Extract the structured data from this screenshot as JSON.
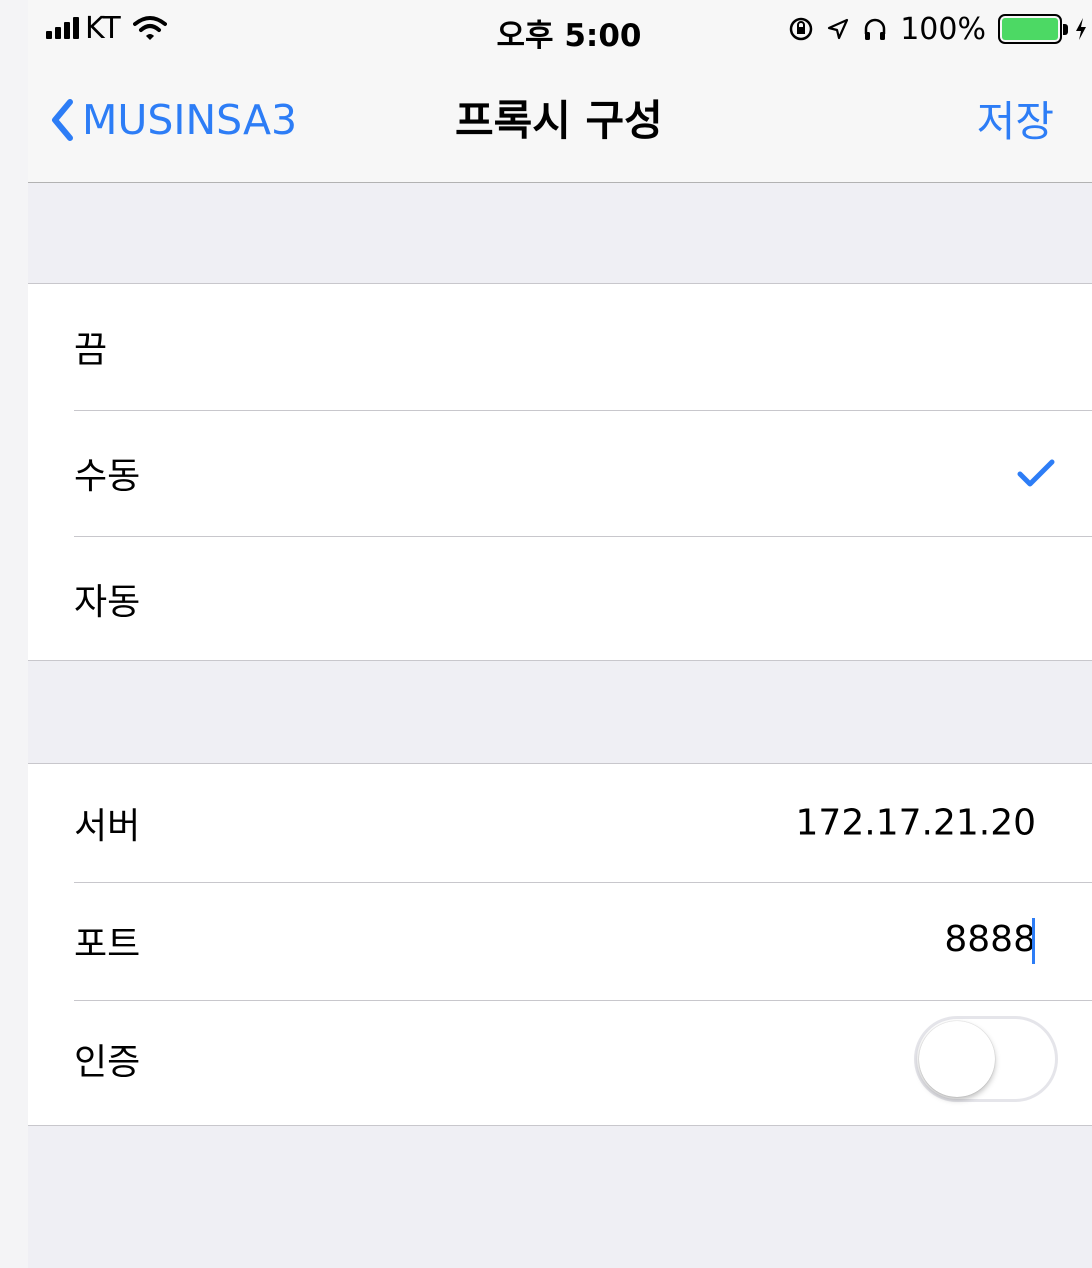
{
  "status_bar": {
    "carrier": "KT",
    "time": "오후 5:00",
    "battery_percent": "100%"
  },
  "nav": {
    "back_label": "MUSINSA3",
    "title": "프록시 구성",
    "save_label": "저장"
  },
  "proxy_modes": [
    {
      "label": "끔",
      "selected": false
    },
    {
      "label": "수동",
      "selected": true
    },
    {
      "label": "자동",
      "selected": false
    }
  ],
  "settings": {
    "server_label": "서버",
    "server_value": "172.17.21.20",
    "port_label": "포트",
    "port_value": "8888",
    "auth_label": "인증",
    "auth_enabled": false
  },
  "colors": {
    "accent": "#2d7df6",
    "battery": "#4cd964",
    "background": "#efeff4"
  }
}
